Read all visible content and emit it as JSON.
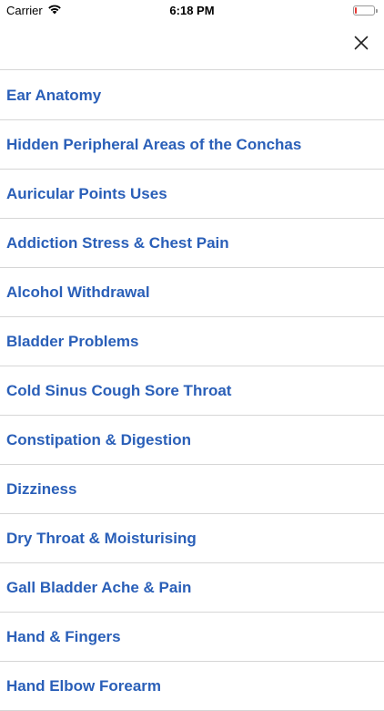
{
  "status": {
    "carrier": "Carrier",
    "time": "6:18 PM",
    "battery_level": 0.1,
    "battery_color": "#e53935"
  },
  "nav": {
    "close_icon": "close-icon"
  },
  "accent_color": "#2a5fb8",
  "items": [
    "Ear Anatomy",
    "Hidden Peripheral Areas of the Conchas",
    "Auricular Points Uses",
    "Addiction Stress & Chest Pain",
    "Alcohol Withdrawal",
    "Bladder Problems",
    "Cold Sinus Cough Sore Throat",
    "Constipation & Digestion",
    "Dizziness",
    "Dry Throat & Moisturising",
    "Gall Bladder Ache & Pain",
    "Hand & Fingers",
    "Hand Elbow Forearm"
  ]
}
